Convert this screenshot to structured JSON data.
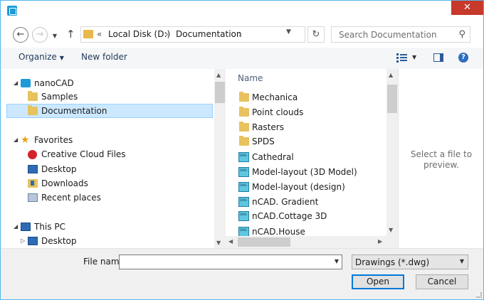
{
  "window": {
    "close_glyph": "✕"
  },
  "address": {
    "chevron": "«",
    "crumbs": [
      "Local Disk (D:)",
      "Documentation"
    ],
    "separator": "›",
    "refresh_glyph": "↻"
  },
  "search": {
    "placeholder": "Search Documentation"
  },
  "toolbar": {
    "organize_label": "Organize",
    "new_folder_label": "New folder",
    "help_glyph": "?"
  },
  "nav_tree": [
    {
      "label": "nanoCAD",
      "icon": "nanocad-icon",
      "expander": "◢"
    },
    {
      "label": "Samples",
      "icon": "folder-icon"
    },
    {
      "label": "Documentation",
      "icon": "folder-icon",
      "selected": true
    },
    {
      "label": "Favorites",
      "icon": "star-icon",
      "expander": "◢"
    },
    {
      "label": "Creative Cloud Files",
      "icon": "creative-cloud-icon"
    },
    {
      "label": "Desktop",
      "icon": "desktop-icon"
    },
    {
      "label": "Downloads",
      "icon": "downloads-icon"
    },
    {
      "label": "Recent places",
      "icon": "recent-places-icon"
    },
    {
      "label": "This PC",
      "icon": "computer-icon",
      "expander": "◢"
    },
    {
      "label": "Desktop",
      "icon": "desktop-icon",
      "expander": "▷"
    }
  ],
  "file_list": {
    "column_name": "Name",
    "items": [
      {
        "label": "Mechanica",
        "type": "folder"
      },
      {
        "label": "Point clouds",
        "type": "folder"
      },
      {
        "label": "Rasters",
        "type": "folder"
      },
      {
        "label": "SPDS",
        "type": "folder"
      },
      {
        "label": "Cathedral",
        "type": "dwg"
      },
      {
        "label": "Model-layout (3D Model)",
        "type": "dwg"
      },
      {
        "label": "Model-layout (design)",
        "type": "dwg"
      },
      {
        "label": "nCAD. Gradient",
        "type": "dwg"
      },
      {
        "label": "nCAD.Cottage 3D",
        "type": "dwg"
      },
      {
        "label": "nCAD.House",
        "type": "dwg"
      }
    ]
  },
  "preview": {
    "text": "Select a file to preview."
  },
  "footer": {
    "file_name_label": "File name:",
    "file_name_value": "",
    "file_type": "Drawings (*.dwg)",
    "open_label": "Open",
    "cancel_label": "Cancel"
  }
}
